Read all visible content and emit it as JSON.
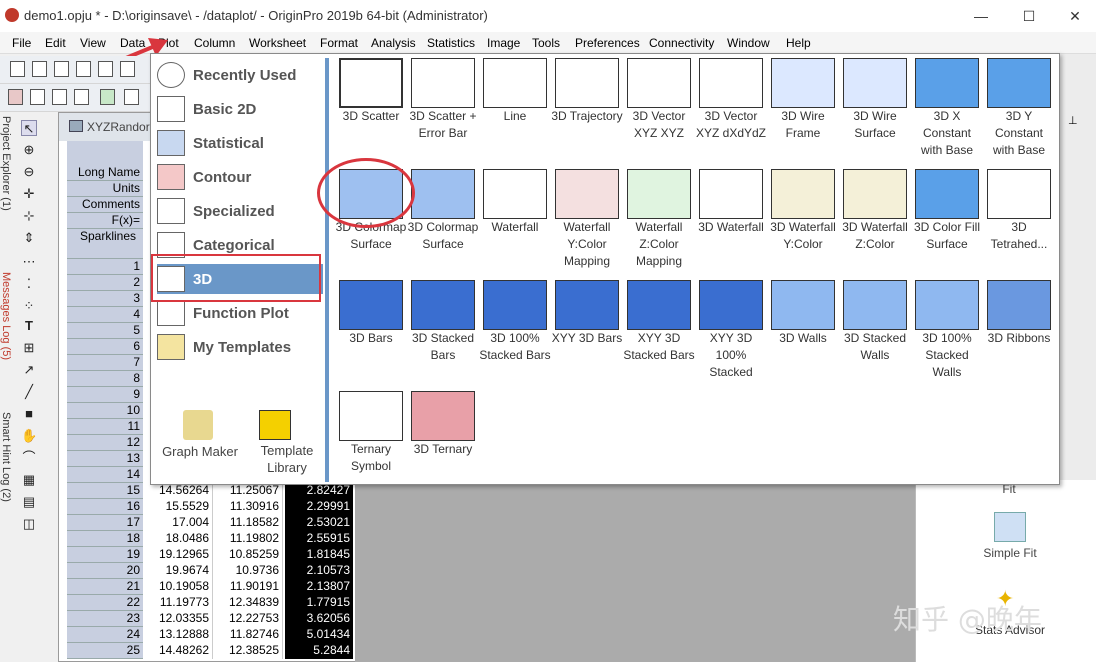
{
  "window": {
    "title": "demo1.opju * - D:\\originsave\\ - /dataplot/ - OriginPro 2019b 64-bit (Administrator)",
    "controls": [
      "—",
      "☐",
      "✕"
    ]
  },
  "menubar": [
    "File",
    "Edit",
    "View",
    "Data",
    "Plot",
    "Column",
    "Worksheet",
    "Format",
    "Analysis",
    "Statistics",
    "Image",
    "Tools",
    "Preferences",
    "Connectivity",
    "Window",
    "Help"
  ],
  "left_panels": {
    "project_explorer": "Project Explorer (1)",
    "messages_log": "Messages Log (5)",
    "smart_hint_log": "Smart Hint Log (2)"
  },
  "worksheet": {
    "title": "XYZRandor",
    "headers": [
      "Long Name",
      "Units",
      "Comments",
      "F(x)=",
      "Sparklines"
    ],
    "rows": [
      {
        "n": "1",
        "a": "",
        "b": "",
        "c": ""
      },
      {
        "n": "2",
        "a": "",
        "b": "",
        "c": ""
      },
      {
        "n": "3",
        "a": "",
        "b": "",
        "c": ""
      },
      {
        "n": "4",
        "a": "",
        "b": "",
        "c": ""
      },
      {
        "n": "5",
        "a": "",
        "b": "",
        "c": ""
      },
      {
        "n": "6",
        "a": "",
        "b": "",
        "c": ""
      },
      {
        "n": "7",
        "a": "",
        "b": "",
        "c": ""
      },
      {
        "n": "8",
        "a": "",
        "b": "",
        "c": ""
      },
      {
        "n": "9",
        "a": "",
        "b": "",
        "c": ""
      },
      {
        "n": "10",
        "a": "",
        "b": "",
        "c": ""
      },
      {
        "n": "11",
        "a": "",
        "b": "",
        "c": ""
      },
      {
        "n": "12",
        "a": "",
        "b": "",
        "c": ""
      },
      {
        "n": "13",
        "a": "",
        "b": "",
        "c": ""
      },
      {
        "n": "14",
        "a": "",
        "b": "",
        "c": ""
      },
      {
        "n": "15",
        "a": "14.56264",
        "b": "11.25067",
        "c": "2.82427"
      },
      {
        "n": "16",
        "a": "15.5529",
        "b": "11.30916",
        "c": "2.29991"
      },
      {
        "n": "17",
        "a": "17.004",
        "b": "11.18582",
        "c": "2.53021"
      },
      {
        "n": "18",
        "a": "18.0486",
        "b": "11.19802",
        "c": "2.55915"
      },
      {
        "n": "19",
        "a": "19.12965",
        "b": "10.85259",
        "c": "1.81845"
      },
      {
        "n": "20",
        "a": "19.9674",
        "b": "10.9736",
        "c": "2.10573"
      },
      {
        "n": "21",
        "a": "10.19058",
        "b": "11.90191",
        "c": "2.13807"
      },
      {
        "n": "22",
        "a": "11.19773",
        "b": "12.34839",
        "c": "1.77915"
      },
      {
        "n": "23",
        "a": "12.03355",
        "b": "12.22753",
        "c": "3.62056"
      },
      {
        "n": "24",
        "a": "13.12888",
        "b": "11.82746",
        "c": "5.01434"
      },
      {
        "n": "25",
        "a": "14.48262",
        "b": "12.38525",
        "c": "5.2844"
      }
    ]
  },
  "plot_menu": {
    "categories": [
      "Recently Used",
      "Basic 2D",
      "Statistical",
      "Contour",
      "Specialized",
      "Categorical",
      "3D",
      "Function Plot",
      "My Templates"
    ],
    "selected": "3D",
    "tools": [
      "Graph Maker",
      "Template Library"
    ],
    "templates": [
      "3D Scatter",
      "3D Scatter + Error Bar",
      "Line",
      "3D Trajectory",
      "3D Vector XYZ XYZ",
      "3D Vector XYZ dXdYdZ",
      "3D Wire Frame",
      "3D Wire Surface",
      "3D X Constant with Base",
      "3D Y Constant with Base",
      "3D Colormap Surface",
      "3D Colormap Surface",
      "Waterfall",
      "Waterfall Y:Color Mapping",
      "Waterfall Z:Color Mapping",
      "3D Waterfall",
      "3D Waterfall Y:Color",
      "3D Waterfall Z:Color",
      "3D Color Fill Surface",
      "3D Tetrahed...",
      "3D Bars",
      "3D Stacked Bars",
      "3D 100% Stacked Bars",
      "XYY 3D Bars",
      "XYY 3D Stacked Bars",
      "XYY 3D 100% Stacked",
      "3D Walls",
      "3D Stacked Walls",
      "3D 100% Stacked Walls",
      "3D Ribbons",
      "Ternary Symbol",
      "3D Ternary"
    ]
  },
  "right_panel": {
    "items": [
      "Fit",
      "Simple Fit",
      "Stats Advisor"
    ]
  },
  "watermark": "知乎 @晚年",
  "colors": {
    "accent": "#6a97c8",
    "annotation": "#d9363e",
    "sheet_header": "#c8cfe0"
  }
}
